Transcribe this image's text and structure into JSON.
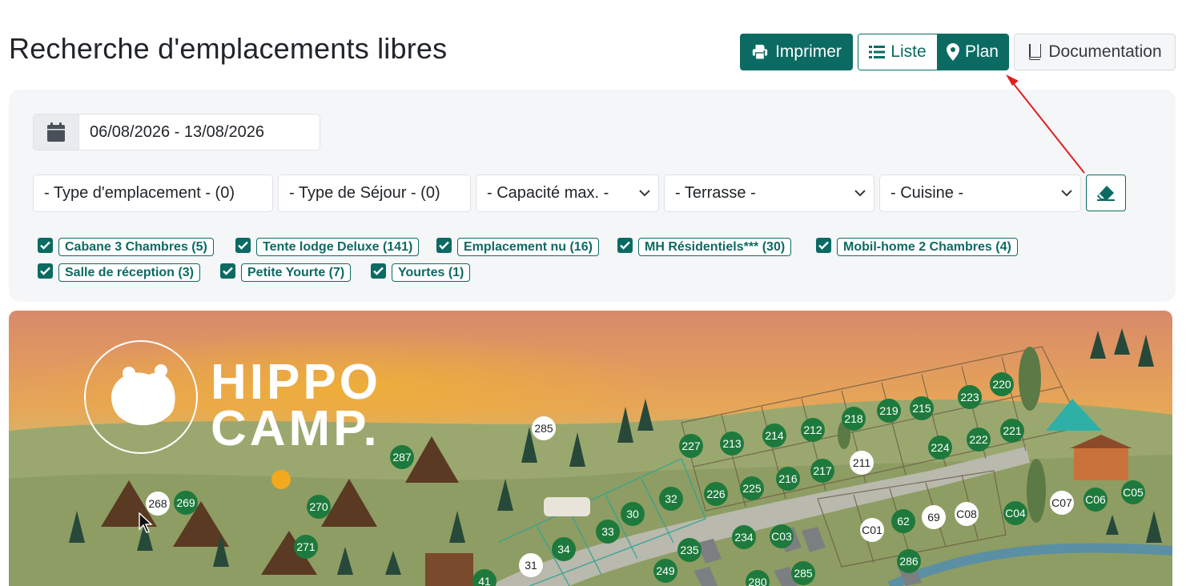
{
  "header": {
    "title": "Recherche d'emplacements libres",
    "print_label": "Imprimer",
    "list_label": "Liste",
    "plan_label": "Plan",
    "doc_label": "Documentation",
    "active_view": "Plan"
  },
  "filters": {
    "date_range": "06/08/2026 - 13/08/2026",
    "selects": [
      {
        "label": "- Type d'emplacement - (0)"
      },
      {
        "label": "- Type de Séjour - (0)"
      },
      {
        "label": "- Capacité max. -"
      },
      {
        "label": "- Terrasse -"
      },
      {
        "label": "- Cuisine -"
      }
    ],
    "checkboxes": [
      {
        "label": "Cabane 3 Chambres (5)",
        "checked": true
      },
      {
        "label": "Tente lodge Deluxe (141)",
        "checked": true
      },
      {
        "label": "Emplacement nu (16)",
        "checked": true
      },
      {
        "label": "MH Résidentiels*** (30)",
        "checked": true
      },
      {
        "label": "Mobil-home 2 Chambres (4)",
        "checked": true
      },
      {
        "label": "Salle de réception (3)",
        "checked": true
      },
      {
        "label": "Petite Yourte (7)",
        "checked": true
      },
      {
        "label": "Yourtes (1)",
        "checked": true
      }
    ]
  },
  "map": {
    "logo_line1": "HIPPO",
    "logo_line2": "CAMP.",
    "pitches": [
      {
        "id": "285",
        "status": "unavailable"
      },
      {
        "id": "287",
        "status": "available"
      },
      {
        "id": "268",
        "status": "unavailable"
      },
      {
        "id": "269",
        "status": "available"
      },
      {
        "id": "270",
        "status": "available"
      },
      {
        "id": "271",
        "status": "available"
      },
      {
        "id": "31",
        "status": "unavailable"
      },
      {
        "id": "34",
        "status": "available"
      },
      {
        "id": "33",
        "status": "available"
      },
      {
        "id": "30",
        "status": "available"
      },
      {
        "id": "32",
        "status": "available"
      },
      {
        "id": "41",
        "status": "available"
      },
      {
        "id": "227",
        "status": "available"
      },
      {
        "id": "213",
        "status": "available"
      },
      {
        "id": "214",
        "status": "available"
      },
      {
        "id": "212",
        "status": "available"
      },
      {
        "id": "218",
        "status": "available"
      },
      {
        "id": "219",
        "status": "available"
      },
      {
        "id": "215",
        "status": "available"
      },
      {
        "id": "223",
        "status": "available"
      },
      {
        "id": "220",
        "status": "available"
      },
      {
        "id": "224",
        "status": "available"
      },
      {
        "id": "222",
        "status": "available"
      },
      {
        "id": "221",
        "status": "available"
      },
      {
        "id": "211",
        "status": "unavailable"
      },
      {
        "id": "226",
        "status": "available"
      },
      {
        "id": "225",
        "status": "available"
      },
      {
        "id": "216",
        "status": "available"
      },
      {
        "id": "217",
        "status": "available"
      },
      {
        "id": "234",
        "status": "available"
      },
      {
        "id": "C03",
        "status": "available"
      },
      {
        "id": "235",
        "status": "available"
      },
      {
        "id": "249",
        "status": "available"
      },
      {
        "id": "280",
        "status": "available"
      },
      {
        "id": "285",
        "status": "available"
      },
      {
        "id": "C01",
        "status": "unavailable"
      },
      {
        "id": "62",
        "status": "available"
      },
      {
        "id": "69",
        "status": "unavailable"
      },
      {
        "id": "C08",
        "status": "unavailable"
      },
      {
        "id": "286",
        "status": "available"
      },
      {
        "id": "C04",
        "status": "available"
      },
      {
        "id": "C07",
        "status": "unavailable"
      },
      {
        "id": "C06",
        "status": "available"
      },
      {
        "id": "C05",
        "status": "available"
      }
    ]
  },
  "colors": {
    "brand": "#0b6b63",
    "available": "#1e7a3c",
    "unavailable": "#ffffff",
    "panel": "#f4f6f8"
  }
}
